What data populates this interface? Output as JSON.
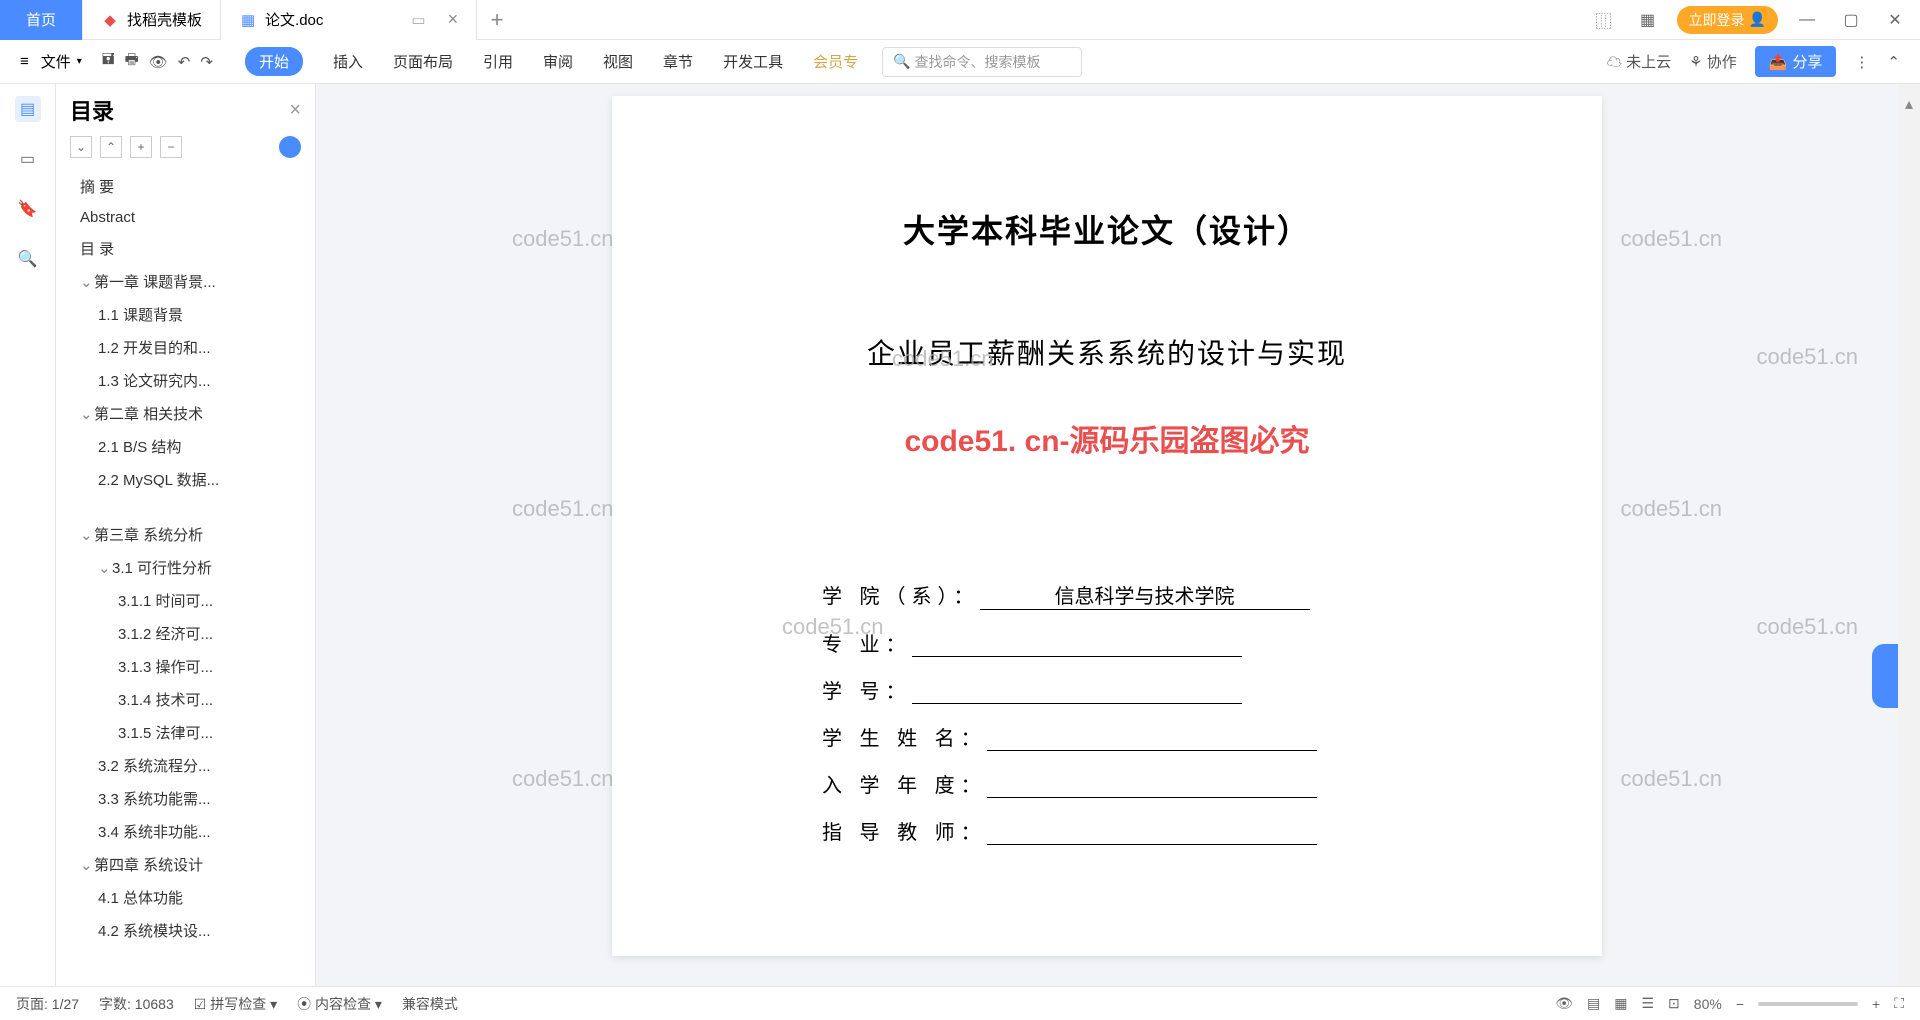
{
  "tabs": {
    "home": "首页",
    "t1": "找稻壳模板",
    "t2": "论文.doc"
  },
  "login": "立即登录",
  "fileMenu": "文件",
  "ribbonTabs": {
    "start": "开始",
    "insert": "插入",
    "layout": "页面布局",
    "ref": "引用",
    "review": "审阅",
    "view": "视图",
    "chapter": "章节",
    "devtools": "开发工具",
    "member": "会员专"
  },
  "searchPlaceholder": "查找命令、搜索模板",
  "cloud": "未上云",
  "collab": "协作",
  "share": "分享",
  "outline": {
    "title": "目录",
    "items": [
      {
        "lvl": 1,
        "text": "摘    要"
      },
      {
        "lvl": 1,
        "text": "Abstract"
      },
      {
        "lvl": 1,
        "text": "目    录"
      },
      {
        "lvl": 1,
        "text": "第一章  课题背景...",
        "chev": true
      },
      {
        "lvl": 2,
        "text": "1.1 课题背景"
      },
      {
        "lvl": 2,
        "text": "1.2 开发目的和..."
      },
      {
        "lvl": 2,
        "text": "1.3 论文研究内..."
      },
      {
        "lvl": 1,
        "text": "第二章  相关技术",
        "chev": true
      },
      {
        "lvl": 2,
        "text": "2.1 B/S 结构"
      },
      {
        "lvl": 2,
        "text": "2.2 MySQL 数据..."
      },
      {
        "lvl": 1,
        "text": "第三章  系统分析",
        "chev": true
      },
      {
        "lvl": 2,
        "text": "3.1 可行性分析",
        "chev": true
      },
      {
        "lvl": 3,
        "text": "3.1.1 时间可..."
      },
      {
        "lvl": 3,
        "text": "3.1.2 经济可..."
      },
      {
        "lvl": 3,
        "text": "3.1.3 操作可..."
      },
      {
        "lvl": 3,
        "text": "3.1.4 技术可..."
      },
      {
        "lvl": 3,
        "text": "3.1.5 法律可..."
      },
      {
        "lvl": 2,
        "text": "3.2 系统流程分..."
      },
      {
        "lvl": 2,
        "text": "3.3 系统功能需..."
      },
      {
        "lvl": 2,
        "text": "3.4 系统非功能..."
      },
      {
        "lvl": 1,
        "text": "第四章  系统设计",
        "chev": true
      },
      {
        "lvl": 2,
        "text": "4.1 总体功能"
      },
      {
        "lvl": 2,
        "text": "4.2 系统模块设..."
      }
    ]
  },
  "doc": {
    "title": "大学本科毕业论文（设计）",
    "subtitle": "企业员工薪酬关系系统的设计与实现",
    "watermarkLine": "code51. cn-源码乐园盗图必究",
    "fields": {
      "college_l": "学 院（系）：",
      "college_v": "信息科学与技术学院",
      "major_l": "专          业：",
      "sid_l": "学          号：",
      "name_l": "学 生 姓 名：",
      "year_l": "入 学 年 度：",
      "advisor_l": "指 导 教 师："
    },
    "wm": "code51.cn"
  },
  "status": {
    "page": "页面: 1/27",
    "words": "字数: 10683",
    "spell": "拼写检查",
    "content": "内容检查",
    "compat": "兼容模式",
    "zoom": "80%"
  }
}
